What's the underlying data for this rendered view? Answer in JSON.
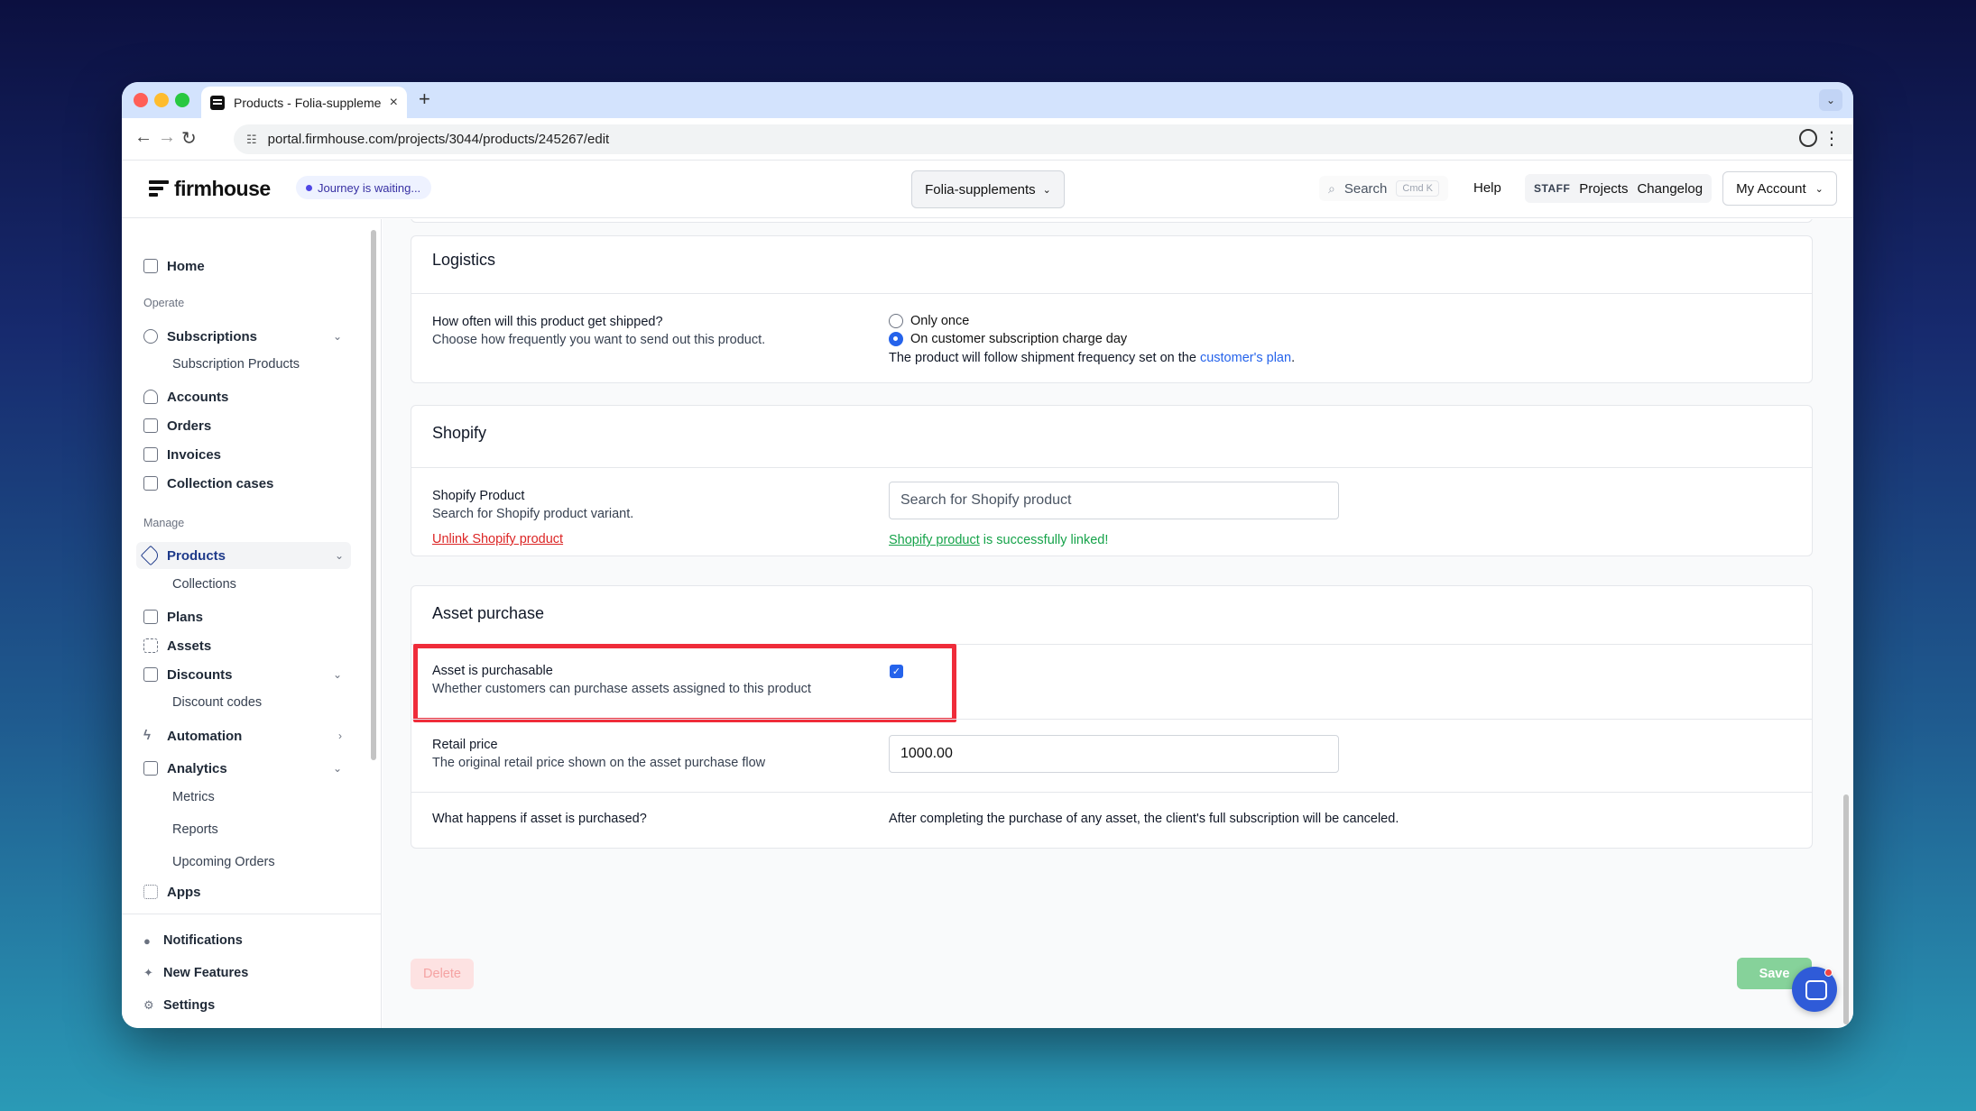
{
  "browser": {
    "tab_title": "Products - Folia-supplements",
    "tab_close": "×",
    "new_tab": "+",
    "url": "portal.firmhouse.com/projects/3044/products/245267/edit"
  },
  "header": {
    "logo_text": "firmhouse",
    "journey_badge": "Journey is waiting...",
    "project_select": "Folia-supplements",
    "search_label": "Search",
    "search_shortcut": "Cmd K",
    "help": "Help",
    "staff_tag": "STAFF",
    "projects": "Projects",
    "changelog": "Changelog",
    "my_account": "My Account"
  },
  "sidebar": {
    "home": "Home",
    "section_operate": "Operate",
    "subscriptions": "Subscriptions",
    "subscription_products": "Subscription Products",
    "accounts": "Accounts",
    "orders": "Orders",
    "invoices": "Invoices",
    "collection_cases": "Collection cases",
    "section_manage": "Manage",
    "products": "Products",
    "collections": "Collections",
    "plans": "Plans",
    "assets": "Assets",
    "discounts": "Discounts",
    "discount_codes": "Discount codes",
    "automation": "Automation",
    "analytics": "Analytics",
    "metrics": "Metrics",
    "reports": "Reports",
    "upcoming_orders": "Upcoming Orders",
    "apps": "Apps",
    "notifications": "Notifications",
    "new_features": "New Features",
    "settings": "Settings"
  },
  "logistics": {
    "title": "Logistics",
    "question": "How often will this product get shipped?",
    "description": "Choose how frequently you want to send out this product.",
    "option_once": "Only once",
    "option_charge_day": "On customer subscription charge day",
    "note_prefix": "The product will follow shipment frequency set on the ",
    "note_link": "customer's plan",
    "note_suffix": "."
  },
  "shopify": {
    "title": "Shopify",
    "product_label": "Shopify Product",
    "product_desc": "Search for Shopify product variant.",
    "unlink": "Unlink Shopify product",
    "search_placeholder": "Search for Shopify product",
    "linked_link": "Shopify product",
    "linked_suffix": " is successfully linked!"
  },
  "asset_purchase": {
    "title": "Asset purchase",
    "purchasable_label": "Asset is purchasable",
    "purchasable_desc": "Whether customers can purchase assets assigned to this product",
    "retail_label": "Retail price",
    "retail_desc": "The original retail price shown on the asset purchase flow",
    "retail_value": "1000.00",
    "what_happens_label": "What happens if asset is purchased?",
    "what_happens_text": "After completing the purchase of any asset, the client's full subscription will be canceled."
  },
  "actions": {
    "delete": "Delete",
    "save": "Save"
  },
  "colors": {
    "accent": "#2563eb",
    "highlight_box": "#ef2c3a",
    "save_button": "#86d29a",
    "delete_button": "#fde2e2"
  }
}
